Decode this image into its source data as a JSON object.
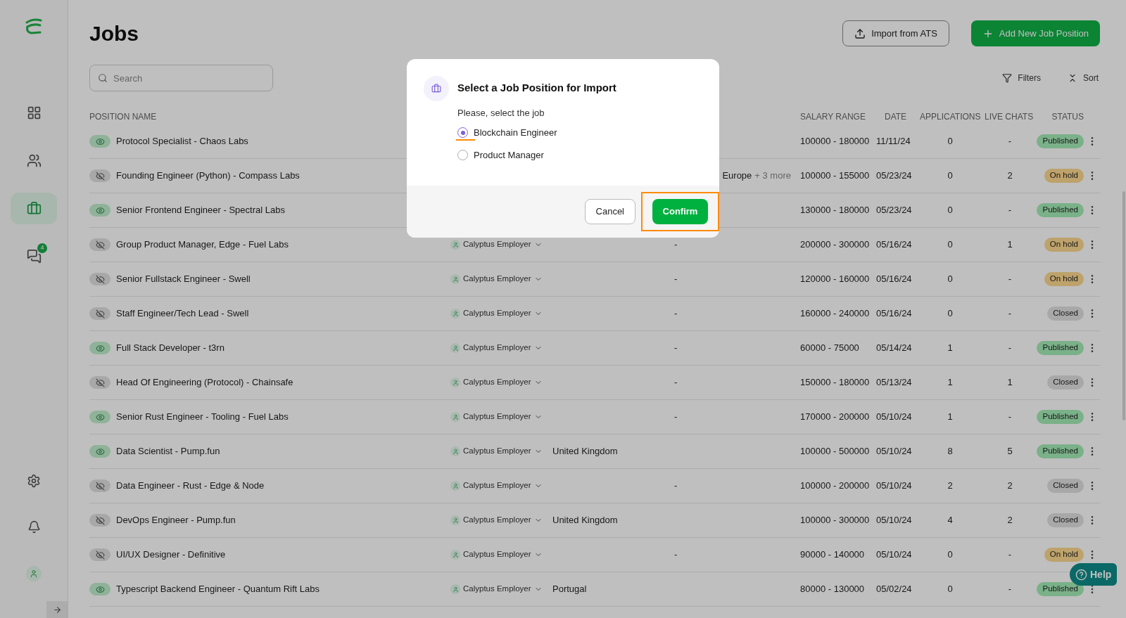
{
  "sidebar": {
    "items": [
      {
        "kind": "dashboard",
        "selected": false
      },
      {
        "kind": "people",
        "selected": false
      },
      {
        "kind": "jobs",
        "selected": true
      },
      {
        "kind": "chats",
        "selected": false,
        "badge": "4"
      }
    ],
    "bottom": [
      {
        "kind": "settings"
      },
      {
        "kind": "bell"
      },
      {
        "kind": "avatar"
      }
    ]
  },
  "header": {
    "title": "Jobs",
    "buttons": [
      {
        "kind": "import",
        "label": "Import from ATS"
      },
      {
        "kind": "add",
        "label": "Add New Job Position"
      }
    ]
  },
  "search": {
    "placeholder": "Search"
  },
  "toolbar": [
    {
      "kind": "filter",
      "label": "Filters"
    },
    {
      "kind": "sort",
      "label": "Sort"
    }
  ],
  "table": {
    "columns": [
      "POSITION NAME",
      "SALARY RANGE",
      "DATE",
      "APPLICATIONS",
      "LIVE CHATS",
      "STATUS"
    ],
    "rows": [
      {
        "visible": true,
        "name": "Protocol Specialist - Chaos Labs",
        "salary": "100000 - 180000",
        "date": "11/11/24",
        "applications": "0",
        "live_chats": "-",
        "status": {
          "label": "Published",
          "kind": "published"
        }
      },
      {
        "visible": false,
        "name": "Founding Engineer (Python) - Compass Labs",
        "location_tail": "Europe",
        "location_more": "+ 3 more",
        "salary": "100000 - 155000",
        "date": "05/23/24",
        "applications": "0",
        "live_chats": "2",
        "status": {
          "label": "On hold",
          "kind": "hold"
        }
      },
      {
        "visible": true,
        "name": "Senior Frontend Engineer - Spectral Labs",
        "salary": "130000 - 180000",
        "date": "05/23/24",
        "applications": "0",
        "live_chats": "-",
        "status": {
          "label": "Published",
          "kind": "published"
        }
      },
      {
        "visible": false,
        "name": "Group Product Manager, Edge - Fuel Labs",
        "owner": "Calyptus Employer",
        "column_4": "-",
        "salary": "200000 - 300000",
        "date": "05/16/24",
        "applications": "0",
        "live_chats": "1",
        "status": {
          "label": "On hold",
          "kind": "hold"
        }
      },
      {
        "visible": false,
        "name": "Senior Fullstack Engineer - Swell",
        "owner": "Calyptus Employer",
        "column_4": "-",
        "salary": "120000 - 160000",
        "date": "05/16/24",
        "applications": "0",
        "live_chats": "-",
        "status": {
          "label": "On hold",
          "kind": "hold"
        }
      },
      {
        "visible": false,
        "name": "Staff Engineer/Tech Lead - Swell",
        "owner": "Calyptus Employer",
        "column_4": "-",
        "salary": "160000 - 240000",
        "date": "05/16/24",
        "applications": "0",
        "live_chats": "-",
        "status": {
          "label": "Closed",
          "kind": "closed"
        }
      },
      {
        "visible": true,
        "name": "Full Stack Developer - t3rn",
        "owner": "Calyptus Employer",
        "column_4": "-",
        "salary": "60000 - 75000",
        "date": "05/14/24",
        "applications": "1",
        "live_chats": "-",
        "status": {
          "label": "Published",
          "kind": "published"
        }
      },
      {
        "visible": false,
        "name": "Head Of Engineering (Protocol) - Chainsafe",
        "owner": "Calyptus Employer",
        "column_4": "-",
        "salary": "150000 - 180000",
        "date": "05/13/24",
        "applications": "1",
        "live_chats": "1",
        "status": {
          "label": "Closed",
          "kind": "closed"
        }
      },
      {
        "visible": true,
        "name": "Senior Rust Engineer - Tooling - Fuel Labs",
        "owner": "Calyptus Employer",
        "column_4": "-",
        "salary": "170000 - 200000",
        "date": "05/10/24",
        "applications": "1",
        "live_chats": "-",
        "status": {
          "label": "Published",
          "kind": "published"
        }
      },
      {
        "visible": true,
        "name": "Data Scientist - Pump.fun",
        "owner": "Calyptus Employer",
        "location": "United Kingdom",
        "salary": "100000 - 500000",
        "date": "05/10/24",
        "applications": "8",
        "live_chats": "5",
        "status": {
          "label": "Published",
          "kind": "published"
        }
      },
      {
        "visible": false,
        "name": "Data Engineer - Rust - Edge & Node",
        "owner": "Calyptus Employer",
        "column_4": "-",
        "salary": "100000 - 200000",
        "date": "05/10/24",
        "applications": "2",
        "live_chats": "2",
        "status": {
          "label": "Closed",
          "kind": "closed"
        }
      },
      {
        "visible": false,
        "name": "DevOps Engineer - Pump.fun",
        "owner": "Calyptus Employer",
        "location": "United Kingdom",
        "salary": "100000 - 300000",
        "date": "05/10/24",
        "applications": "4",
        "live_chats": "2",
        "status": {
          "label": "Closed",
          "kind": "closed"
        }
      },
      {
        "visible": false,
        "name": "UI/UX Designer - Definitive",
        "owner": "Calyptus Employer",
        "column_4": "-",
        "salary": "90000 - 140000",
        "date": "05/10/24",
        "applications": "0",
        "live_chats": "-",
        "status": {
          "label": "On hold",
          "kind": "hold"
        }
      },
      {
        "visible": true,
        "name": "Typescript Backend Engineer - Quantum Rift Labs",
        "owner": "Calyptus Employer",
        "location": "Portugal",
        "salary": "80000 - 130000",
        "date": "05/02/24",
        "applications": "0",
        "live_chats": "-",
        "status": {
          "label": "Published",
          "kind": "published"
        }
      }
    ]
  },
  "help": {
    "label": "Help"
  },
  "dialog": {
    "title": "Select a Job Position for Import",
    "prompt": "Please, select the job",
    "options": [
      {
        "label": "Blockchain Engineer",
        "selected": true
      },
      {
        "label": "Product Manager",
        "selected": false
      }
    ],
    "buttons": [
      {
        "kind": "cancel",
        "label": "Cancel"
      },
      {
        "kind": "confirm",
        "label": "Confirm"
      }
    ]
  }
}
